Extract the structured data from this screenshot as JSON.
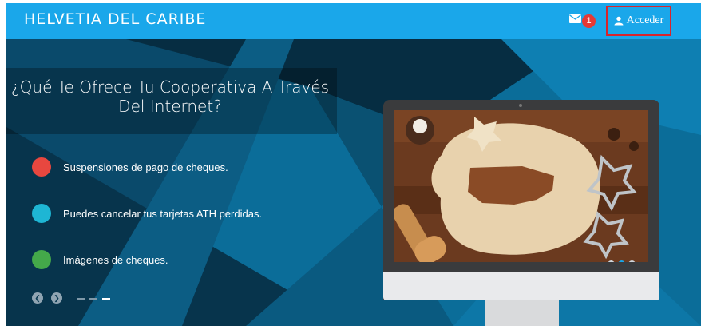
{
  "header": {
    "brand": "HELVETIA DEL CARIBE",
    "notification_count": "1",
    "login_label": "Acceder"
  },
  "hero": {
    "title_line1": "¿Qué Te Ofrece Tu Cooperativa A Través",
    "title_line2": "Del Internet?",
    "features": [
      {
        "text": "Suspensiones de pago de cheques.",
        "color": "#e8473f"
      },
      {
        "text": "Puedes cancelar tus tarjetas ATH perdidas.",
        "color": "#1eb6d4"
      },
      {
        "text": "Imágenes de cheques.",
        "color": "#44a84a"
      }
    ],
    "carousel": {
      "slides": 3,
      "active": 3
    },
    "image_carousel": {
      "slides": 3,
      "active": 2
    }
  },
  "colors": {
    "header_bg": "#1aa7ea",
    "hero_bg": "#0b6d99",
    "badge": "#e53935",
    "login_border": "#d9242b"
  }
}
